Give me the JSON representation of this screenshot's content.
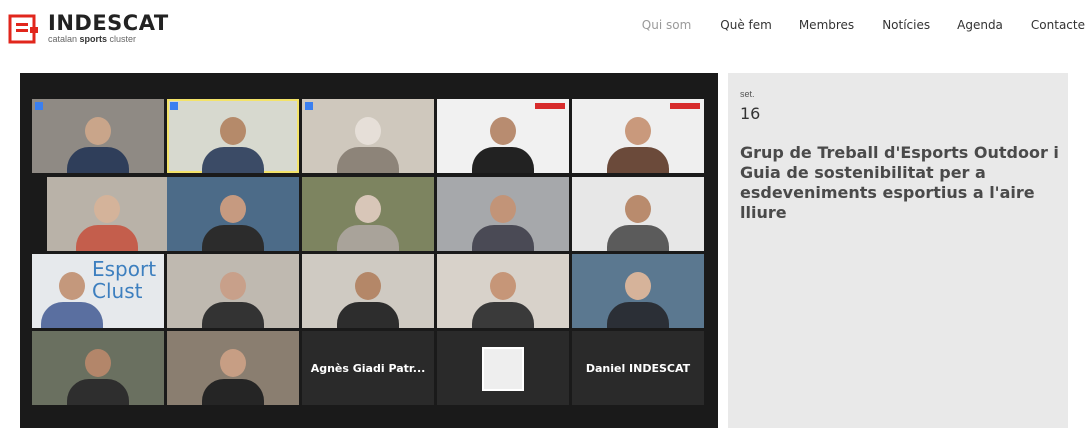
{
  "brand": {
    "title": "INDESCAT",
    "subtitle_prefix": "catalan ",
    "subtitle_bold": "sports",
    "subtitle_suffix": " cluster",
    "color": "#e1261c"
  },
  "nav": {
    "items": [
      "Qui som",
      "Què fem",
      "Membres",
      "Notícies",
      "Agenda",
      "Contacte"
    ],
    "active_color": "#333333",
    "inactive_color": "#9a9a9a"
  },
  "event": {
    "month": "set.",
    "day": "16",
    "title": "Grup de Treball d'Esports Outdoor i Guia de sostenibilitat per a esdeveniments esportius a l'aire lliure"
  },
  "meeting": {
    "name_cards": [
      "Agnès Giadi Patr...",
      "Daniel INDESCAT"
    ],
    "poster_text": [
      "Esport",
      "Clust"
    ]
  }
}
